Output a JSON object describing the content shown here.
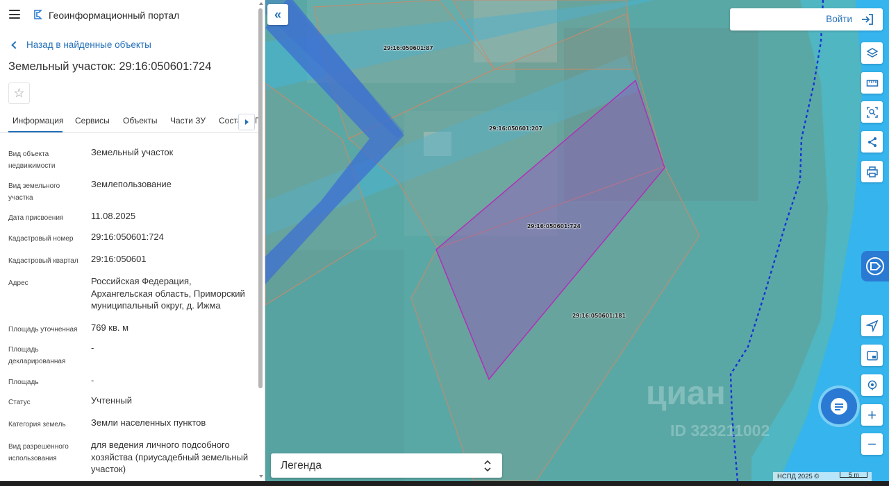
{
  "app": {
    "title": "Геоинформационный портал"
  },
  "nav": {
    "back_label": "Назад в найденные объекты"
  },
  "object": {
    "title": "Земельный участок: 29:16:050601:724"
  },
  "tabs": [
    {
      "label": "Информация",
      "active": true
    },
    {
      "label": "Сервисы"
    },
    {
      "label": "Объекты"
    },
    {
      "label": "Части ЗУ"
    },
    {
      "label": "Соста"
    },
    {
      "label": "Г"
    }
  ],
  "fields": [
    {
      "label": "Вид объекта недвижимости",
      "value": "Земельный участок"
    },
    {
      "label": "Вид земельного участка",
      "value": "Землепользование"
    },
    {
      "label": "Дата присвоения",
      "value": "11.08.2025"
    },
    {
      "label": "Кадастровый номер",
      "value": "29:16:050601:724"
    },
    {
      "label": "Кадастровый квартал",
      "value": "29:16:050601"
    },
    {
      "label": "Адрес",
      "value": "Российская Федерация, Архангельская область, Приморский муниципальный округ, д. Ижма"
    },
    {
      "label": "Площадь уточненная",
      "value": "769 кв. м"
    },
    {
      "label": "Площадь декларированная",
      "value": "-"
    },
    {
      "label": "Площадь",
      "value": "-"
    },
    {
      "label": "Статус",
      "value": "Учтенный"
    },
    {
      "label": "Категория земель",
      "value": "Земли населенных пунктов"
    },
    {
      "label": "Вид разрешенного использования",
      "value": "для ведения личного подсобного хозяйства (приусадебный земельный участок)"
    }
  ],
  "map": {
    "login_label": "Войти",
    "legend_label": "Легенда",
    "parcels": [
      "29:16:050601:87",
      "29:16:050601:207",
      "29:16:050601:724",
      "29:16:050601:181"
    ],
    "attribution": "НСПД 2025 ©",
    "scale_label": "5 m",
    "watermark": "циан",
    "watermark_id": "ID 323211002",
    "colors": {
      "water": "#35b4ee",
      "selected_parcel": "#b030b8",
      "parcel_border": "#c98a6a",
      "accent": "#2370b8"
    }
  },
  "icons": [
    "menu-icon",
    "logo-icon",
    "chevron-left-icon",
    "star-icon",
    "double-chevron-left-icon",
    "login-icon",
    "layers-icon",
    "ruler-icon",
    "select-area-icon",
    "share-icon",
    "print-icon",
    "navigate-icon",
    "picture-in-picture-icon",
    "location-icon",
    "zoom-in-icon",
    "zoom-out-icon",
    "chat-icon"
  ]
}
